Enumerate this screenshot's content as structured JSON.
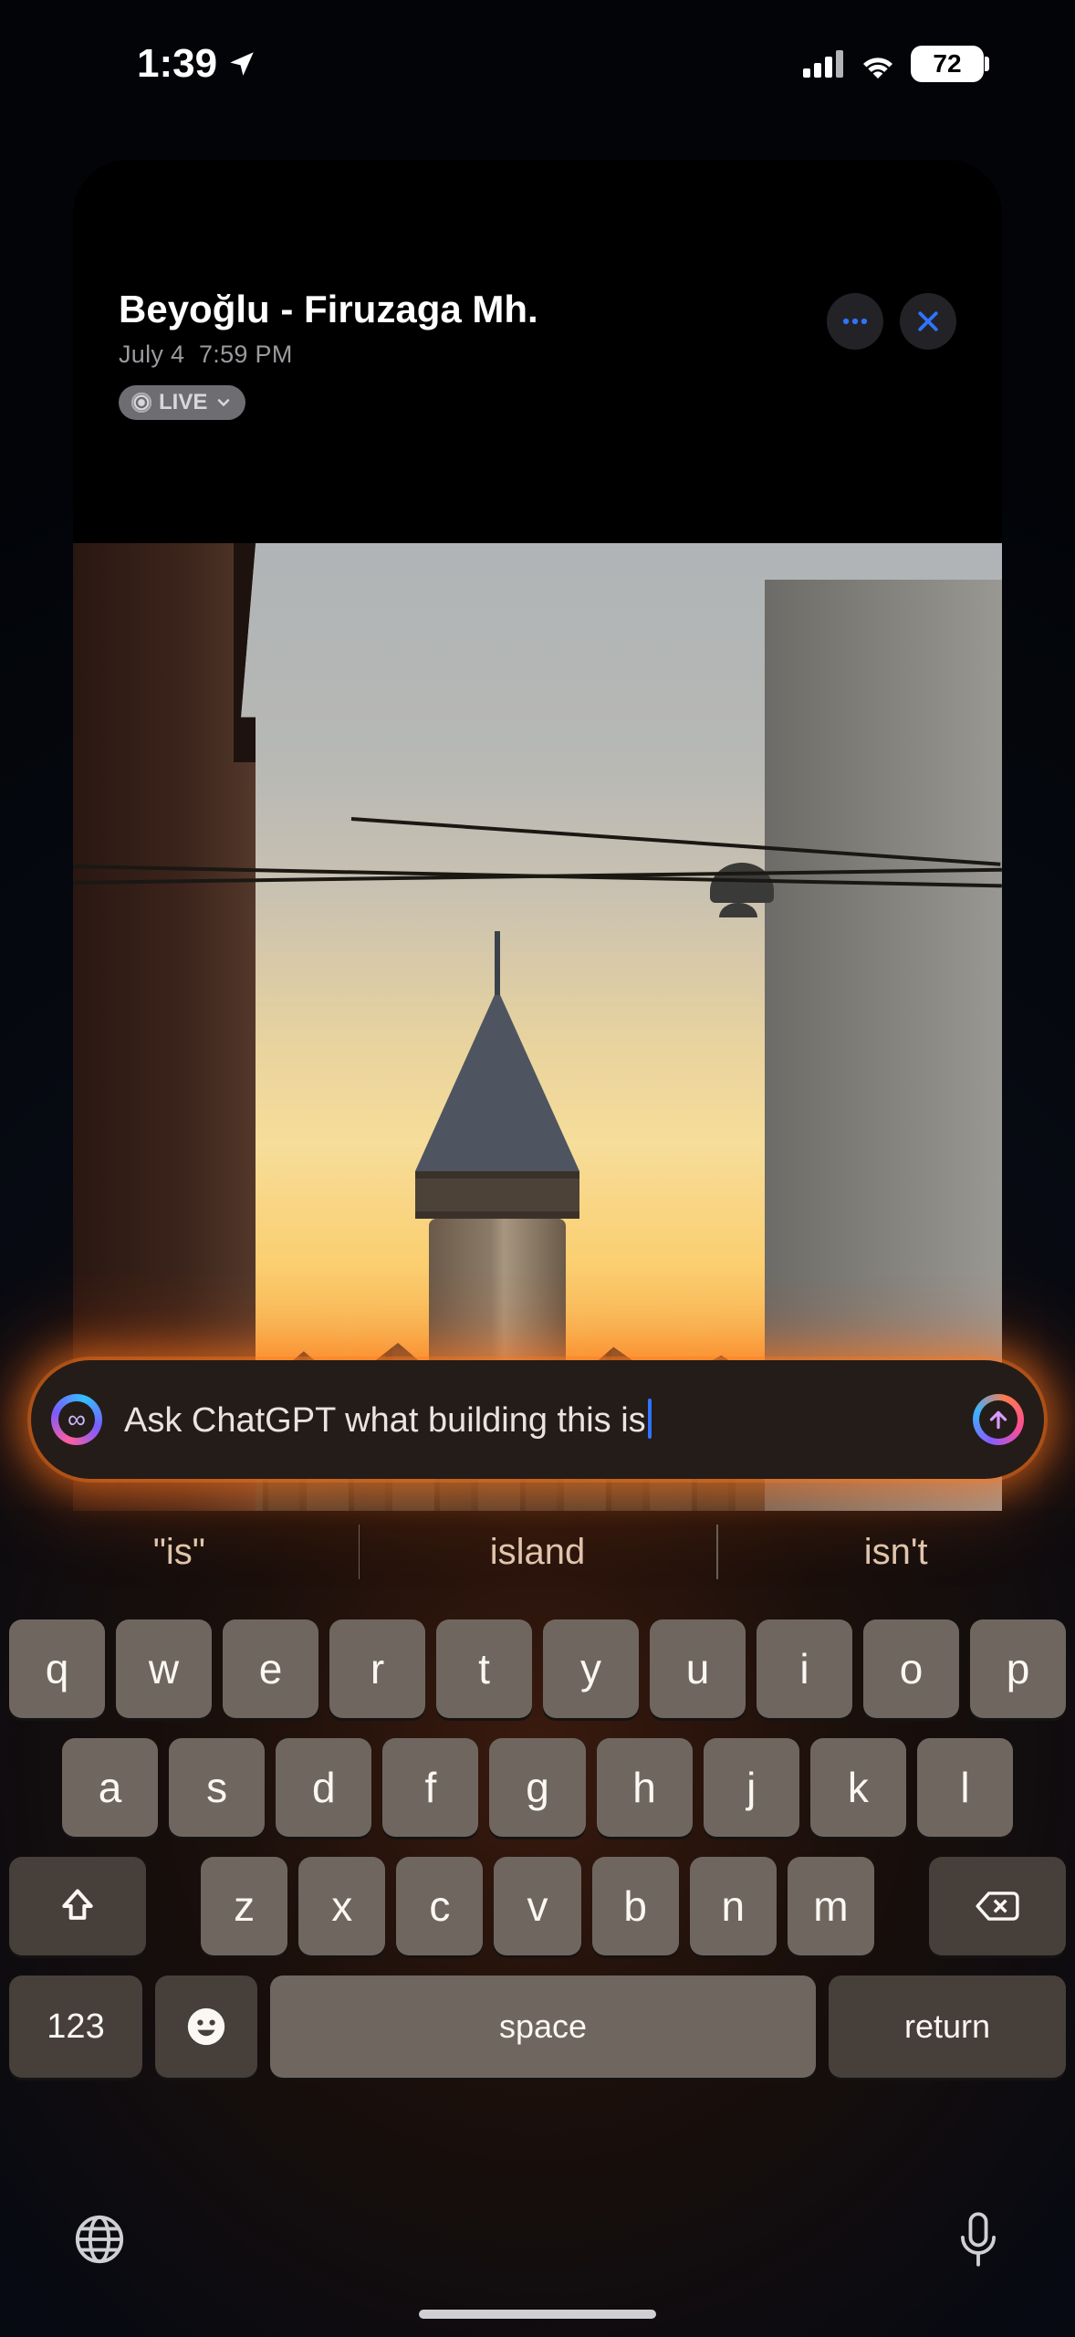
{
  "status": {
    "time": "1:39",
    "battery": "72"
  },
  "card": {
    "title": "Beyoğlu - Firuzaga Mh.",
    "date": "July 4",
    "time": "7:59 PM",
    "live_label": "LIVE"
  },
  "input": {
    "text": "Ask ChatGPT what building this is"
  },
  "predictions": [
    "\"is\"",
    "island",
    "isn't"
  ],
  "keyboard": {
    "row1": [
      "q",
      "w",
      "e",
      "r",
      "t",
      "y",
      "u",
      "i",
      "o",
      "p"
    ],
    "row2": [
      "a",
      "s",
      "d",
      "f",
      "g",
      "h",
      "j",
      "k",
      "l"
    ],
    "row3": [
      "z",
      "x",
      "c",
      "v",
      "b",
      "n",
      "m"
    ],
    "numbers_label": "123",
    "space_label": "space",
    "return_label": "return"
  }
}
